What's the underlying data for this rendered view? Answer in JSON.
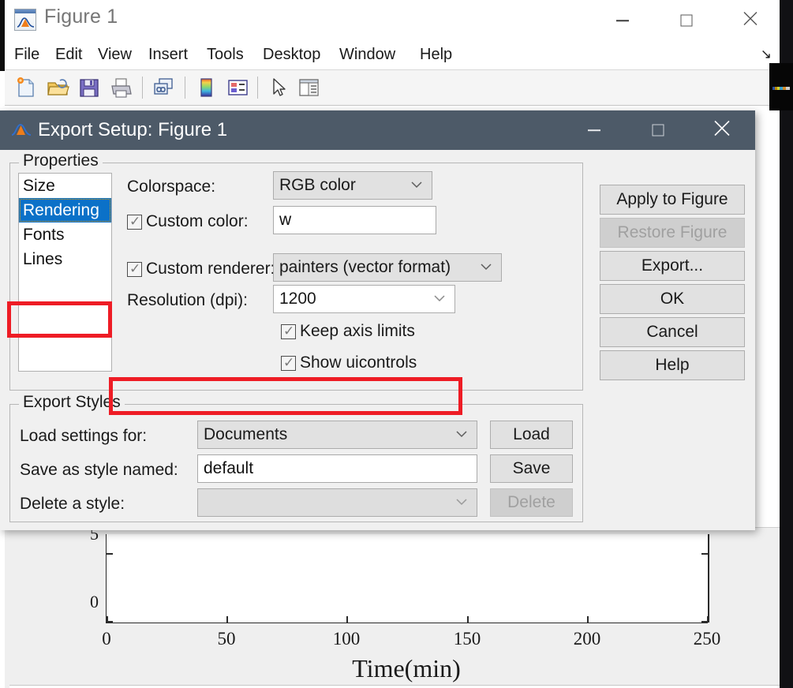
{
  "figure_window": {
    "title": "Figure 1",
    "title_icon": "matlab-figure-icon",
    "menus": [
      "File",
      "Edit",
      "View",
      "Insert",
      "Tools",
      "Desktop",
      "Window",
      "Help"
    ],
    "dock_icon": "dock-arrow-icon",
    "window_controls": {
      "minimize": "minimize-icon",
      "maximize": "maximize-icon",
      "close": "close-icon"
    },
    "toolbar": [
      "new-figure-icon",
      "open-file-icon",
      "save-figure-icon",
      "print-figure-icon",
      "link-plot-icon",
      "insert-colorbar-icon",
      "insert-legend-icon",
      "edit-plot-pointer-icon",
      "show-plot-tools-icon"
    ]
  },
  "dialog": {
    "title": "Export Setup: Figure 1",
    "title_icon": "matlab-figure-icon",
    "window_controls": {
      "minimize": "minimize-icon",
      "maximize": "maximize-icon",
      "close": "close-icon"
    },
    "properties": {
      "legend": "Properties",
      "list_items": [
        "Size",
        "Rendering",
        "Fonts",
        "Lines"
      ],
      "selected_item": "Rendering",
      "fields": {
        "colorspace_label": "Colorspace:",
        "colorspace_value": "RGB color",
        "custom_color_label": "Custom color:",
        "custom_color_checked": true,
        "custom_color_value": "w",
        "custom_renderer_label": "Custom renderer:",
        "custom_renderer_checked": true,
        "custom_renderer_value": "painters (vector format)",
        "resolution_label": "Resolution (dpi):",
        "resolution_value": "1200",
        "keep_axis_limits_label": "Keep axis limits",
        "keep_axis_limits_checked": true,
        "show_uicontrols_label": "Show uicontrols",
        "show_uicontrols_checked": true
      }
    },
    "export_styles": {
      "legend": "Export Styles",
      "load_settings_label": "Load settings for:",
      "load_settings_value": "Documents",
      "load_button": "Load",
      "save_as_label": "Save as style named:",
      "save_as_value": "default",
      "save_button": "Save",
      "delete_style_label": "Delete a style:",
      "delete_style_value": "",
      "delete_button": "Delete",
      "delete_button_disabled": true
    },
    "action_buttons": [
      {
        "label": "Apply to Figure",
        "disabled": false
      },
      {
        "label": "Restore Figure",
        "disabled": true
      },
      {
        "label": "Export...",
        "disabled": false
      },
      {
        "label": "OK",
        "disabled": false
      },
      {
        "label": "Cancel",
        "disabled": false
      },
      {
        "label": "Help",
        "disabled": false
      }
    ],
    "annotations": {
      "color": "#ee1c25",
      "boxes": [
        "rendering-list-item",
        "resolution-dpi-row"
      ]
    }
  },
  "chart_data": {
    "type": "line",
    "title": "",
    "xlabel": "Time(min)",
    "ylabel": "",
    "x": [],
    "values": [],
    "xticks": [
      0,
      50,
      100,
      150,
      200,
      250
    ],
    "xticklabels": [
      "0",
      "50",
      "100",
      "150",
      "200",
      "250"
    ],
    "yticks": [
      0,
      5
    ],
    "yticklabels": [
      "0",
      "5"
    ],
    "xlim": [
      0,
      250
    ],
    "ylim": [
      0,
      6.5
    ],
    "grid": false,
    "legend": "none",
    "note": "Plot axes partially occluded by the Export Setup dialog; no data series visible in the exposed region."
  }
}
